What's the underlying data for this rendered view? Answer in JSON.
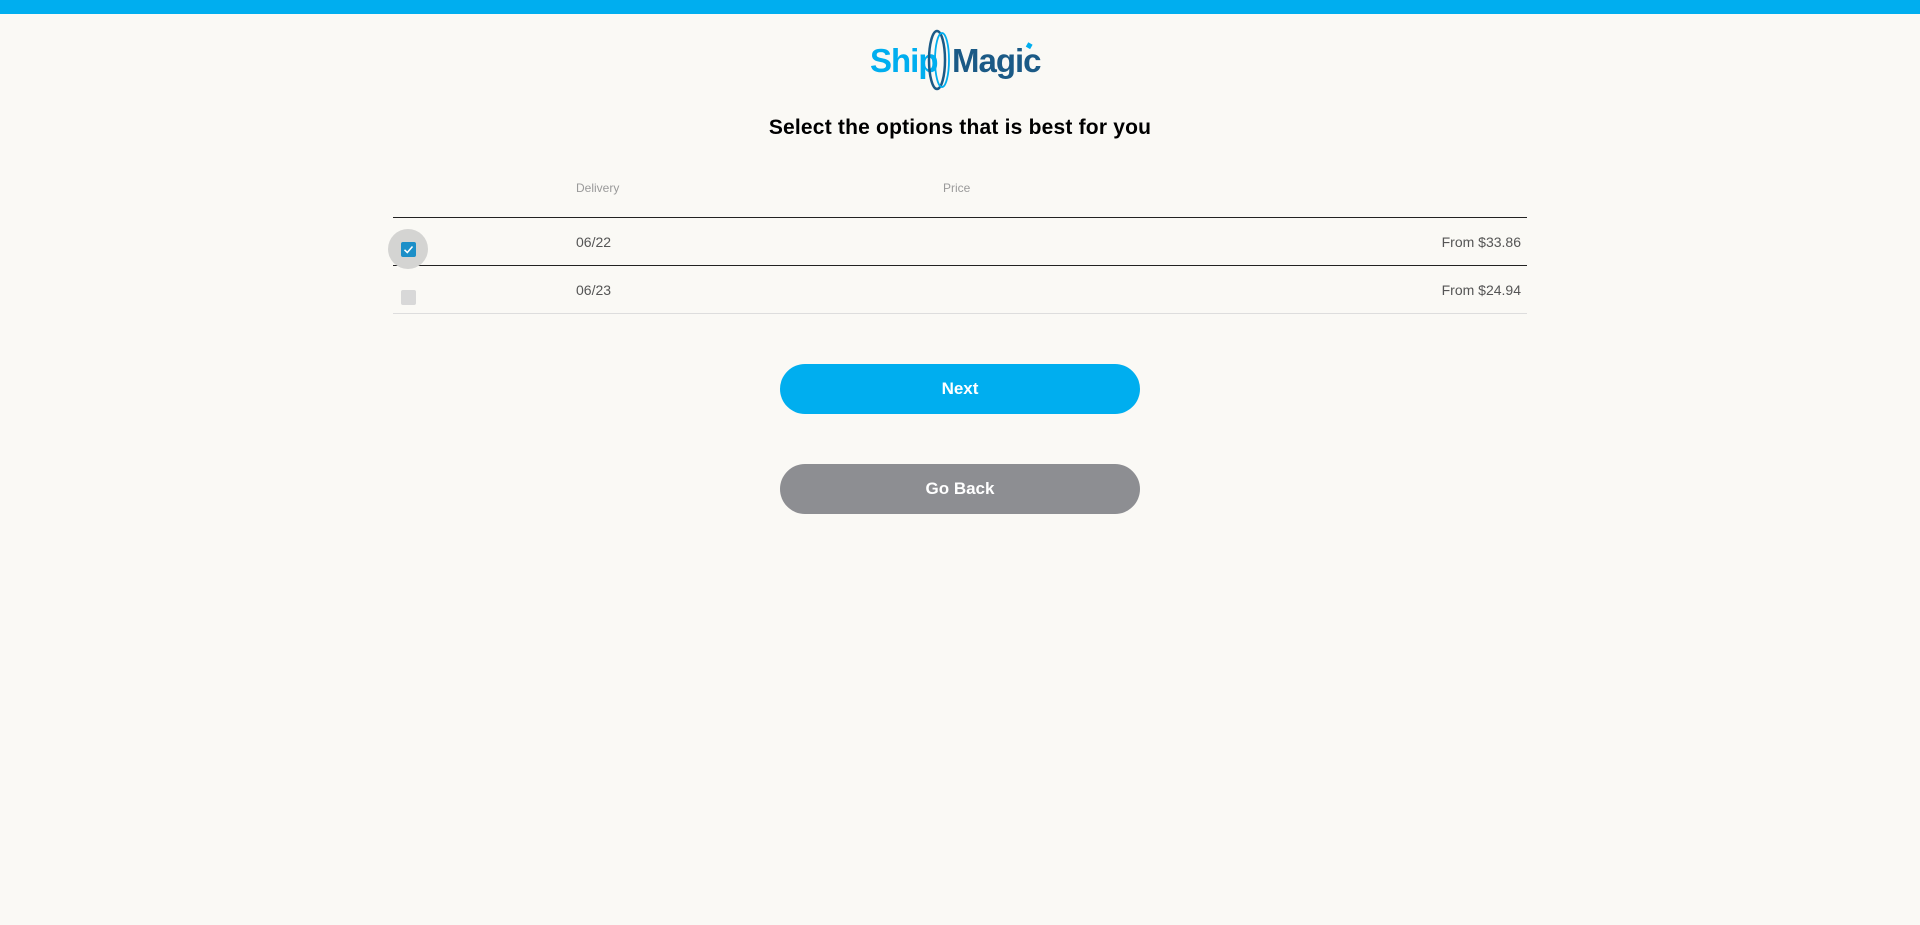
{
  "brand": {
    "logo_text": "ShipMagic",
    "logo_part1": "Ship",
    "logo_part2": "Magic",
    "colors": {
      "accent": "#00aeef",
      "dark": "#1b5a86"
    }
  },
  "heading": "Select the options that is best for you",
  "table": {
    "columns": [
      "Delivery",
      "Price"
    ],
    "rows": [
      {
        "delivery": "06/22",
        "price": "From $33.86",
        "selected": true
      },
      {
        "delivery": "06/23",
        "price": "From $24.94",
        "selected": false
      }
    ]
  },
  "buttons": {
    "next": "Next",
    "back": "Go Back"
  },
  "icons": {
    "checkbox_checked": "checkmark-icon"
  }
}
